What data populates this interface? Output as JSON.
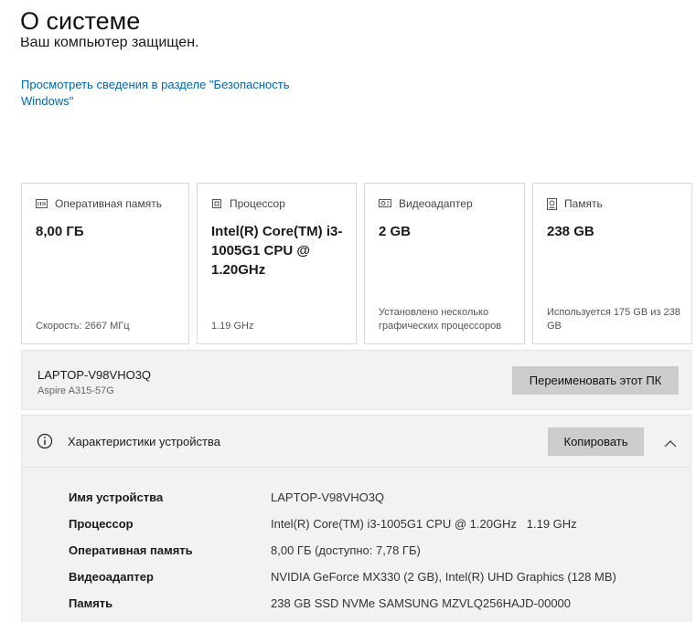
{
  "page": {
    "title": "О системе",
    "protected_text": "Ваш компьютер защищен.",
    "security_link": "Просмотреть сведения в разделе \"Безопасность Windows\""
  },
  "cards": [
    {
      "icon": "memory-icon",
      "label": "Оперативная память",
      "value": "8,00 ГБ",
      "footer": "Скорость: 2667 МГц"
    },
    {
      "icon": "processor-icon",
      "label": "Процессор",
      "value": "Intel(R) Core(TM) i3-1005G1 CPU @ 1.20GHz",
      "footer": "1.19 GHz"
    },
    {
      "icon": "display-adapter-icon",
      "label": "Видеоадаптер",
      "value": "2 GB",
      "footer": "Установлено несколько графических процессоров"
    },
    {
      "icon": "storage-icon",
      "label": "Память",
      "value": "238 GB",
      "footer": "Используется 175 GB из 238 GB"
    }
  ],
  "pc": {
    "name": "LAPTOP-V98VHO3Q",
    "model": "Aspire A315-57G",
    "rename_label": "Переименовать этот ПК"
  },
  "specs": {
    "title": "Характеристики устройства",
    "copy_label": "Копировать",
    "rows": [
      {
        "label": "Имя устройства",
        "value": "LAPTOP-V98VHO3Q"
      },
      {
        "label": "Процессор",
        "value": "Intel(R) Core(TM) i3-1005G1 CPU @ 1.20GHz   1.19 GHz"
      },
      {
        "label": "Оперативная память",
        "value": "8,00 ГБ (доступно: 7,78 ГБ)"
      },
      {
        "label": "Видеоадаптер",
        "value": "NVIDIA GeForce MX330 (2 GB), Intel(R) UHD Graphics (128 MB)"
      },
      {
        "label": "Память",
        "value": "238 GB SSD NVMe SAMSUNG MZVLQ256HAJD-00000"
      }
    ]
  }
}
